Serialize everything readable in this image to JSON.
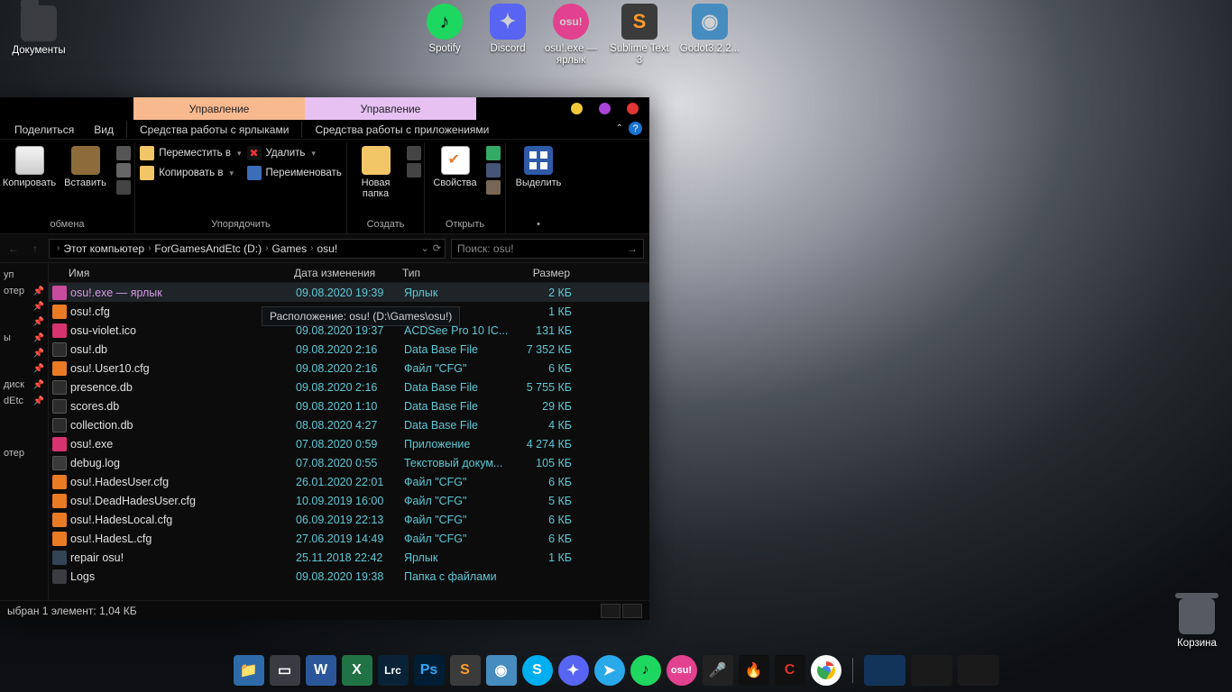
{
  "desktop": {
    "docs": "Документы",
    "spotify": "Spotify",
    "discord": "Discord",
    "osu": "osu!.exe — ярлык",
    "sublime": "Sublime Text 3",
    "godot": "Godot3.2.2...",
    "trash": "Корзина"
  },
  "explorer": {
    "tab_manage1": "Управление",
    "tab_manage2": "Управление",
    "cmd_share": "Поделиться",
    "cmd_view": "Вид",
    "cmd_shortcut_tools": "Средства работы с ярлыками",
    "cmd_app_tools": "Средства работы с приложениями",
    "ribbon": {
      "copy": "Копировать",
      "paste": "Вставить",
      "clipboard_group": "обмена",
      "move_to": "Переместить в",
      "copy_to": "Копировать в",
      "delete": "Удалить",
      "rename": "Переименовать",
      "organize_group": "Упорядочить",
      "new_folder": "Новая папка",
      "create_group": "Создать",
      "properties": "Свойства",
      "open_group": "Открыть",
      "select": "Выделить",
      "bullet": "•"
    },
    "breadcrumb": {
      "this_pc": "Этот компьютер",
      "drive": "ForGamesAndEtc (D:)",
      "games": "Games",
      "osu": "osu!"
    },
    "search_placeholder": "Поиск: osu!",
    "sidebar": {
      "i0": "уп",
      "i1": "отер",
      "i2": "ы",
      "i3": "диск",
      "i4": "dEtc",
      "i5": "отер"
    },
    "columns": {
      "name": "Имя",
      "date": "Дата изменения",
      "type": "Тип",
      "size": "Размер"
    },
    "tooltip": "Расположение: osu! (D:\\Games\\osu!)",
    "files": [
      {
        "ico": "shortcut",
        "name": "osu!.exe — ярлык",
        "date": "09.08.2020 19:39",
        "type": "Ярлык",
        "size": "2 КБ",
        "sel": true
      },
      {
        "ico": "cfg",
        "name": "osu!.cfg",
        "date": "",
        "type": "",
        "size": "1 КБ"
      },
      {
        "ico": "ico",
        "name": "osu-violet.ico",
        "date": "09.08.2020 19:37",
        "type": "ACDSee Pro 10 IC...",
        "size": "131 КБ"
      },
      {
        "ico": "db",
        "name": "osu!.db",
        "date": "09.08.2020 2:16",
        "type": "Data Base File",
        "size": "7 352 КБ"
      },
      {
        "ico": "cfg",
        "name": "osu!.User10.cfg",
        "date": "09.08.2020 2:16",
        "type": "Файл \"CFG\"",
        "size": "6 КБ"
      },
      {
        "ico": "db",
        "name": "presence.db",
        "date": "09.08.2020 2:16",
        "type": "Data Base File",
        "size": "5 755 КБ"
      },
      {
        "ico": "db",
        "name": "scores.db",
        "date": "09.08.2020 1:10",
        "type": "Data Base File",
        "size": "29 КБ"
      },
      {
        "ico": "db",
        "name": "collection.db",
        "date": "08.08.2020 4:27",
        "type": "Data Base File",
        "size": "4 КБ"
      },
      {
        "ico": "exe",
        "name": "osu!.exe",
        "date": "07.08.2020 0:59",
        "type": "Приложение",
        "size": "4 274 КБ"
      },
      {
        "ico": "log",
        "name": "debug.log",
        "date": "07.08.2020 0:55",
        "type": "Текстовый докум...",
        "size": "105 КБ"
      },
      {
        "ico": "cfg",
        "name": "osu!.HadesUser.cfg",
        "date": "26.01.2020 22:01",
        "type": "Файл \"CFG\"",
        "size": "6 КБ"
      },
      {
        "ico": "cfg",
        "name": "osu!.DeadHadesUser.cfg",
        "date": "10.09.2019 16:00",
        "type": "Файл \"CFG\"",
        "size": "5 КБ"
      },
      {
        "ico": "cfg",
        "name": "osu!.HadesLocal.cfg",
        "date": "06.09.2019 22:13",
        "type": "Файл \"CFG\"",
        "size": "6 КБ"
      },
      {
        "ico": "cfg",
        "name": "osu!.HadesL.cfg",
        "date": "27.06.2019 14:49",
        "type": "Файл \"CFG\"",
        "size": "6 КБ"
      },
      {
        "ico": "repair",
        "name": "repair osu!",
        "date": "25.11.2018 22:42",
        "type": "Ярлык",
        "size": "1 КБ"
      },
      {
        "ico": "folder",
        "name": "Logs",
        "date": "09.08.2020 19:38",
        "type": "Папка с файлами",
        "size": ""
      }
    ],
    "status": "ыбран 1 элемент: 1,04 КБ"
  }
}
